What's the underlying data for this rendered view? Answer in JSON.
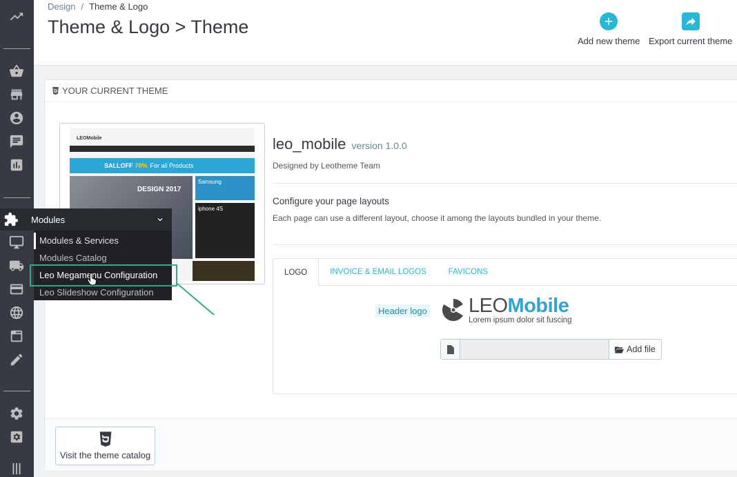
{
  "breadcrumb": {
    "parent": "Design",
    "current": "Theme & Logo"
  },
  "page_title": "Theme & Logo > Theme",
  "toolbar": {
    "add_theme": "Add new theme",
    "export_theme": "Export current theme"
  },
  "panel": {
    "heading": "YOUR CURRENT THEME",
    "visit_catalog": "Visit the theme catalog"
  },
  "theme": {
    "name": "leo_mobile",
    "version": "version 1.0.0",
    "designed_by": "Designed by Leotheme Team",
    "config_title": "Configure your page layouts",
    "config_desc": "Each page can use a different layout, choose it among the layouts bundled in your theme."
  },
  "preview": {
    "logo": "LEOMobile",
    "promo_a": "SALLOFF",
    "promo_b": "70%",
    "promo_c": "For all Products",
    "hero": "DESIGN 2017",
    "tile_1": "Samsung",
    "tile_2": "iphone 4S"
  },
  "tabs": [
    "LOGO",
    "INVOICE & EMAIL LOGOS",
    "FAVICONS"
  ],
  "logo_tab": {
    "label": "Header logo",
    "logo_left": "LEO",
    "logo_right": "Mobile",
    "logo_sub": "Lorem ipsum dolor sit fuscing",
    "add_file": "Add file"
  },
  "menu": {
    "title": "Modules",
    "items": [
      "Modules & Services",
      "Modules Catalog",
      "Leo Megamenu Configuration",
      "Leo Slideshow Configuration"
    ]
  },
  "colors": {
    "sidebar": "#363a41",
    "accent": "#25b9d7",
    "highlight": "#2dab8a"
  }
}
